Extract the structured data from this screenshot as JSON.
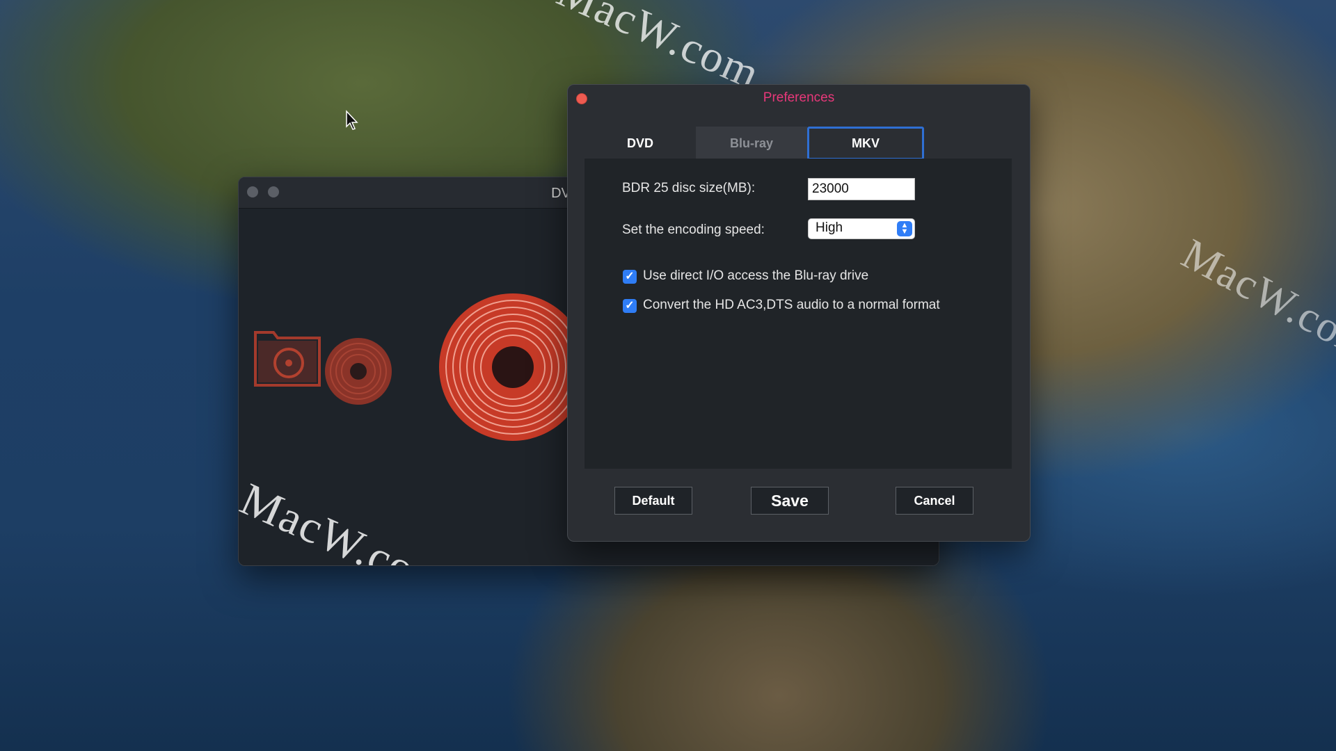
{
  "main_window": {
    "title": "DVD-Cloner",
    "watermark": "MacW.com"
  },
  "desktop_watermarks": [
    "MacW.com",
    "MacW.com"
  ],
  "preferences": {
    "title": "Preferences",
    "tabs": [
      {
        "label": "DVD",
        "selected": false
      },
      {
        "label": "Blu-ray",
        "selected": false
      },
      {
        "label": "MKV",
        "selected": true
      }
    ],
    "disc_size_label": "BDR 25 disc size(MB):",
    "disc_size_value": "23000",
    "encoding_speed_label": "Set the encoding speed:",
    "encoding_speed_value": "High",
    "options": [
      {
        "label": "Use direct I/O access the Blu-ray drive",
        "checked": true
      },
      {
        "label": "Convert the HD AC3,DTS audio to a normal format",
        "checked": true
      }
    ],
    "buttons": {
      "default": "Default",
      "save": "Save",
      "cancel": "Cancel"
    }
  },
  "colors": {
    "accent_blue": "#2f7df6",
    "title_pink": "#e8387a",
    "close_red": "#ee5b51",
    "disc_red": "#e0452e"
  }
}
